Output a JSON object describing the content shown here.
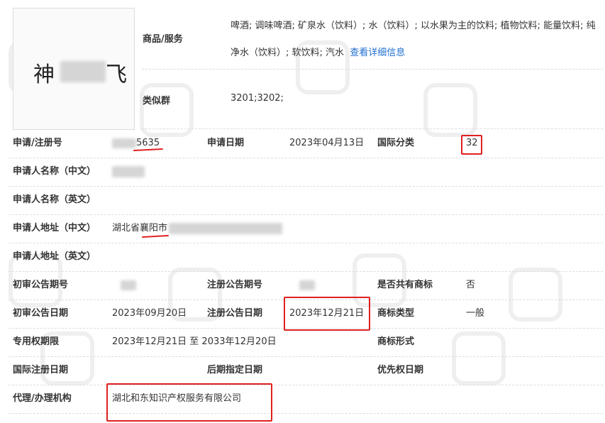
{
  "logo": {
    "char_left": "神",
    "char_right": "飞"
  },
  "goods": {
    "label": "商品/服务",
    "text": "啤酒; 调味啤酒; 矿泉水（饮料）; 水（饮料）; 以水果为主的饮料; 植物饮料; 能量饮料; 纯净水（饮料）; 软饮料; 汽水",
    "link": "查看详细信息"
  },
  "similar_group": {
    "label": "类似群",
    "value": "3201;3202;"
  },
  "rows": {
    "reg_no": {
      "label": "申请/注册号",
      "value": "5635"
    },
    "apply_date": {
      "label": "申请日期",
      "value": "2023年04月13日"
    },
    "intl_class": {
      "label": "国际分类",
      "value": "32"
    },
    "applicant_cn": {
      "label": "申请人名称（中文）"
    },
    "applicant_en": {
      "label": "申请人名称（英文）"
    },
    "address_cn": {
      "label": "申请人地址（中文）",
      "value": "湖北省襄阳市"
    },
    "address_en": {
      "label": "申请人地址（英文）"
    },
    "prelim_no": {
      "label": "初审公告期号"
    },
    "reg_pub_no": {
      "label": "注册公告期号"
    },
    "shared": {
      "label": "是否共有商标",
      "value": "否"
    },
    "prelim_date": {
      "label": "初审公告日期",
      "value": "2023年09月20日"
    },
    "reg_pub_date": {
      "label": "注册公告日期",
      "value": "2023年12月21日"
    },
    "tm_type": {
      "label": "商标类型",
      "value": "一般"
    },
    "exclusive_period": {
      "label": "专用权期限",
      "value": "2023年12月21日 至 2033年12月20日"
    },
    "tm_form": {
      "label": "商标形式"
    },
    "intl_reg_date": {
      "label": "国际注册日期"
    },
    "later_date": {
      "label": "后期指定日期"
    },
    "priority_date": {
      "label": "优先权日期"
    },
    "agent": {
      "label": "代理/办理机构",
      "value": "湖北和东知识产权服务有限公司"
    }
  },
  "colors": {
    "highlight": "#e02020",
    "link": "#1f6fd1",
    "watermark": "#f0f0f0"
  }
}
